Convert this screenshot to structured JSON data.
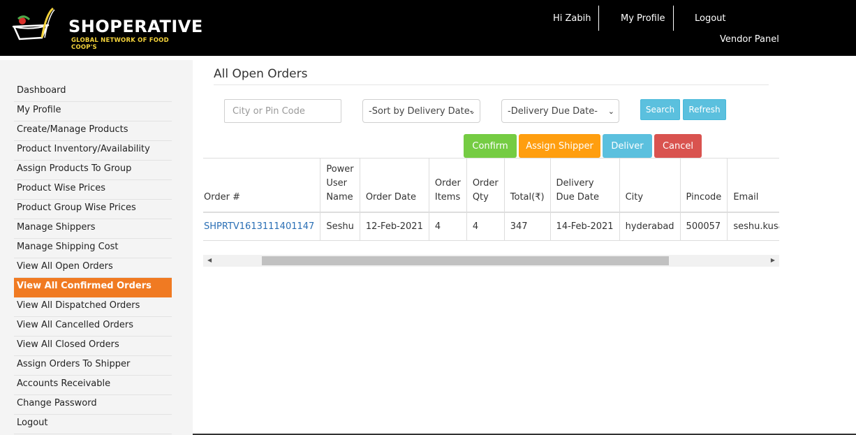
{
  "brand": {
    "title": "SHOPERATIVE",
    "subtitle": "GLOBAL NETWORK OF FOOD COOP'S"
  },
  "header": {
    "greeting": "Hi Zabih",
    "profile_label": "My Profile",
    "logout_label": "Logout",
    "panel_label": "Vendor Panel"
  },
  "sidebar": {
    "items": [
      {
        "label": "Dashboard",
        "active": false
      },
      {
        "label": "My Profile",
        "active": false
      },
      {
        "label": "Create/Manage Products",
        "active": false
      },
      {
        "label": "Product Inventory/Availability",
        "active": false
      },
      {
        "label": "Assign Products To Group",
        "active": false
      },
      {
        "label": "Product Wise Prices",
        "active": false
      },
      {
        "label": "Product Group Wise Prices",
        "active": false
      },
      {
        "label": "Manage Shippers",
        "active": false
      },
      {
        "label": "Manage Shipping Cost",
        "active": false
      },
      {
        "label": "View All Open Orders",
        "active": false
      },
      {
        "label": "View All Confirmed Orders",
        "active": true
      },
      {
        "label": "View All Dispatched Orders",
        "active": false
      },
      {
        "label": "View All Cancelled Orders",
        "active": false
      },
      {
        "label": "View All Closed Orders",
        "active": false
      },
      {
        "label": "Assign Orders To Shipper",
        "active": false
      },
      {
        "label": "Accounts Receivable",
        "active": false
      },
      {
        "label": "Change Password",
        "active": false
      },
      {
        "label": "Logout",
        "active": false
      }
    ]
  },
  "main": {
    "title": "All Open Orders",
    "filters": {
      "city_placeholder": "City or Pin Code",
      "city_value": "",
      "sort_selected": "-Sort by Delivery Date-",
      "due_selected": "-Delivery Due Date-",
      "search_label": "Search",
      "refresh_label": "Refresh"
    },
    "actions": {
      "confirm": "Confirm",
      "assign_shipper": "Assign Shipper",
      "deliver": "Deliver",
      "cancel": "Cancel"
    },
    "table": {
      "headers": [
        "Order #",
        "Power User Name",
        "Order Date",
        "Order Items",
        "Order Qty",
        "Total(₹)",
        "Delivery Due Date",
        "City",
        "Pincode",
        "Email"
      ],
      "rows": [
        {
          "order_no": "SHPRTV1613111401147",
          "power_user": "Seshu",
          "order_date": "12-Feb-2021",
          "order_items": "4",
          "order_qty": "4",
          "total": "347",
          "due_date": "14-Feb-2021",
          "city": "hyderabad",
          "pincode": "500057",
          "email": "seshu.kusa"
        }
      ]
    }
  },
  "colors": {
    "header_bg": "#000000",
    "accent_active": "#f07a22",
    "confirm": "#75cc43",
    "assign": "#ff9e0f",
    "deliver": "#5bc0de",
    "cancel": "#d9534f",
    "link": "#2a6fb5"
  }
}
